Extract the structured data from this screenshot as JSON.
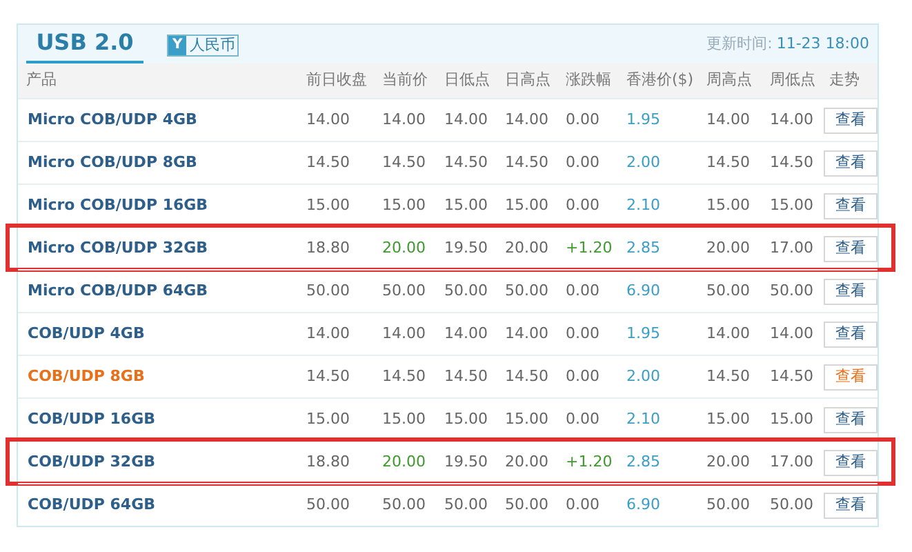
{
  "header": {
    "tab": {
      "label": "USB 2.0",
      "selected": true
    },
    "currency": {
      "symbol": "Y",
      "label": "人民币"
    },
    "update_label": "更新时间:",
    "update_time": "11-23 18:00"
  },
  "table": {
    "columns": [
      "产品",
      "前日收盘",
      "当前价",
      "日低点",
      "日高点",
      "涨跌幅",
      "香港价($)",
      "周高点",
      "周低点",
      "走势"
    ],
    "rows": [
      {
        "product": "Micro COB/UDP 4GB",
        "prev_close": "14.00",
        "current": "14.00",
        "day_low": "14.00",
        "day_high": "14.00",
        "change": "0.00",
        "hk_price": "1.95",
        "week_high": "14.00",
        "week_low": "14.00",
        "action": "查看",
        "kind": "flat",
        "highlighted": false,
        "active": false
      },
      {
        "product": "Micro COB/UDP 8GB",
        "prev_close": "14.50",
        "current": "14.50",
        "day_low": "14.50",
        "day_high": "14.50",
        "change": "0.00",
        "hk_price": "2.00",
        "week_high": "14.50",
        "week_low": "14.50",
        "action": "查看",
        "kind": "flat",
        "highlighted": false,
        "active": false
      },
      {
        "product": "Micro COB/UDP 16GB",
        "prev_close": "15.00",
        "current": "15.00",
        "day_low": "15.00",
        "day_high": "15.00",
        "change": "0.00",
        "hk_price": "2.10",
        "week_high": "15.00",
        "week_low": "15.00",
        "action": "查看",
        "kind": "flat",
        "highlighted": false,
        "active": false
      },
      {
        "product": "Micro COB/UDP 32GB",
        "prev_close": "18.80",
        "current": "20.00",
        "day_low": "19.50",
        "day_high": "20.00",
        "change": "+1.20",
        "hk_price": "2.85",
        "week_high": "20.00",
        "week_low": "17.00",
        "action": "查看",
        "kind": "up",
        "highlighted": true,
        "active": false
      },
      {
        "product": "Micro COB/UDP 64GB",
        "prev_close": "50.00",
        "current": "50.00",
        "day_low": "50.00",
        "day_high": "50.00",
        "change": "0.00",
        "hk_price": "6.90",
        "week_high": "50.00",
        "week_low": "50.00",
        "action": "查看",
        "kind": "flat",
        "highlighted": false,
        "active": false
      },
      {
        "product": "COB/UDP 4GB",
        "prev_close": "14.00",
        "current": "14.00",
        "day_low": "14.00",
        "day_high": "14.00",
        "change": "0.00",
        "hk_price": "1.95",
        "week_high": "14.00",
        "week_low": "14.00",
        "action": "查看",
        "kind": "flat",
        "highlighted": false,
        "active": false
      },
      {
        "product": "COB/UDP 8GB",
        "prev_close": "14.50",
        "current": "14.50",
        "day_low": "14.50",
        "day_high": "14.50",
        "change": "0.00",
        "hk_price": "2.00",
        "week_high": "14.50",
        "week_low": "14.50",
        "action": "查看",
        "kind": "flat",
        "highlighted": false,
        "active": true
      },
      {
        "product": "COB/UDP 16GB",
        "prev_close": "15.00",
        "current": "15.00",
        "day_low": "15.00",
        "day_high": "15.00",
        "change": "0.00",
        "hk_price": "2.10",
        "week_high": "15.00",
        "week_low": "15.00",
        "action": "查看",
        "kind": "flat",
        "highlighted": false,
        "active": false
      },
      {
        "product": "COB/UDP 32GB",
        "prev_close": "18.80",
        "current": "20.00",
        "day_low": "19.50",
        "day_high": "20.00",
        "change": "+1.20",
        "hk_price": "2.85",
        "week_high": "20.00",
        "week_low": "17.00",
        "action": "查看",
        "kind": "up",
        "highlighted": true,
        "active": false
      },
      {
        "product": "COB/UDP 64GB",
        "prev_close": "50.00",
        "current": "50.00",
        "day_low": "50.00",
        "day_high": "50.00",
        "change": "0.00",
        "hk_price": "6.90",
        "week_high": "50.00",
        "week_low": "50.00",
        "action": "查看",
        "kind": "flat",
        "highlighted": false,
        "active": false
      }
    ]
  }
}
